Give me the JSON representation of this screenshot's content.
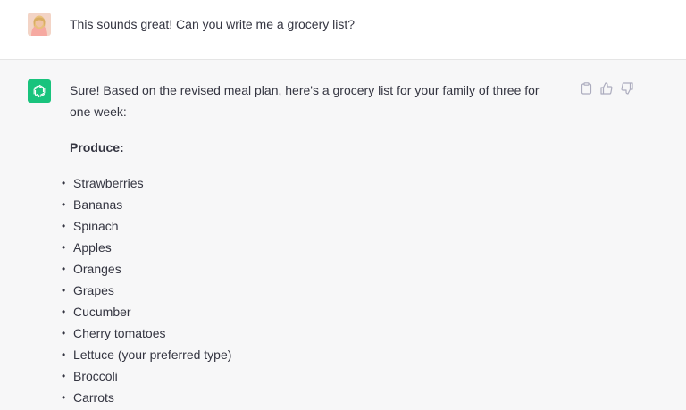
{
  "user_message": {
    "text": "This sounds great! Can you write me a grocery list?",
    "avatar": "user-avatar-photo"
  },
  "assistant_message": {
    "icon": "openai-logo-icon",
    "intro": "Sure! Based on the revised meal plan, here's a grocery list for your family of three for one week:",
    "section_title": "Produce:",
    "items": [
      "Strawberries",
      "Bananas",
      "Spinach",
      "Apples",
      "Oranges",
      "Grapes",
      "Cucumber",
      "Cherry tomatoes",
      "Lettuce (your preferred type)",
      "Broccoli",
      "Carrots"
    ]
  },
  "actions": {
    "copy_icon": "clipboard-icon",
    "like_icon": "thumbs-up-icon",
    "dislike_icon": "thumbs-down-icon"
  },
  "colors": {
    "assistant_bg": "#f7f7f8",
    "bot_green": "#19c37d",
    "text": "#343541",
    "icon_gray": "#acacbe"
  }
}
